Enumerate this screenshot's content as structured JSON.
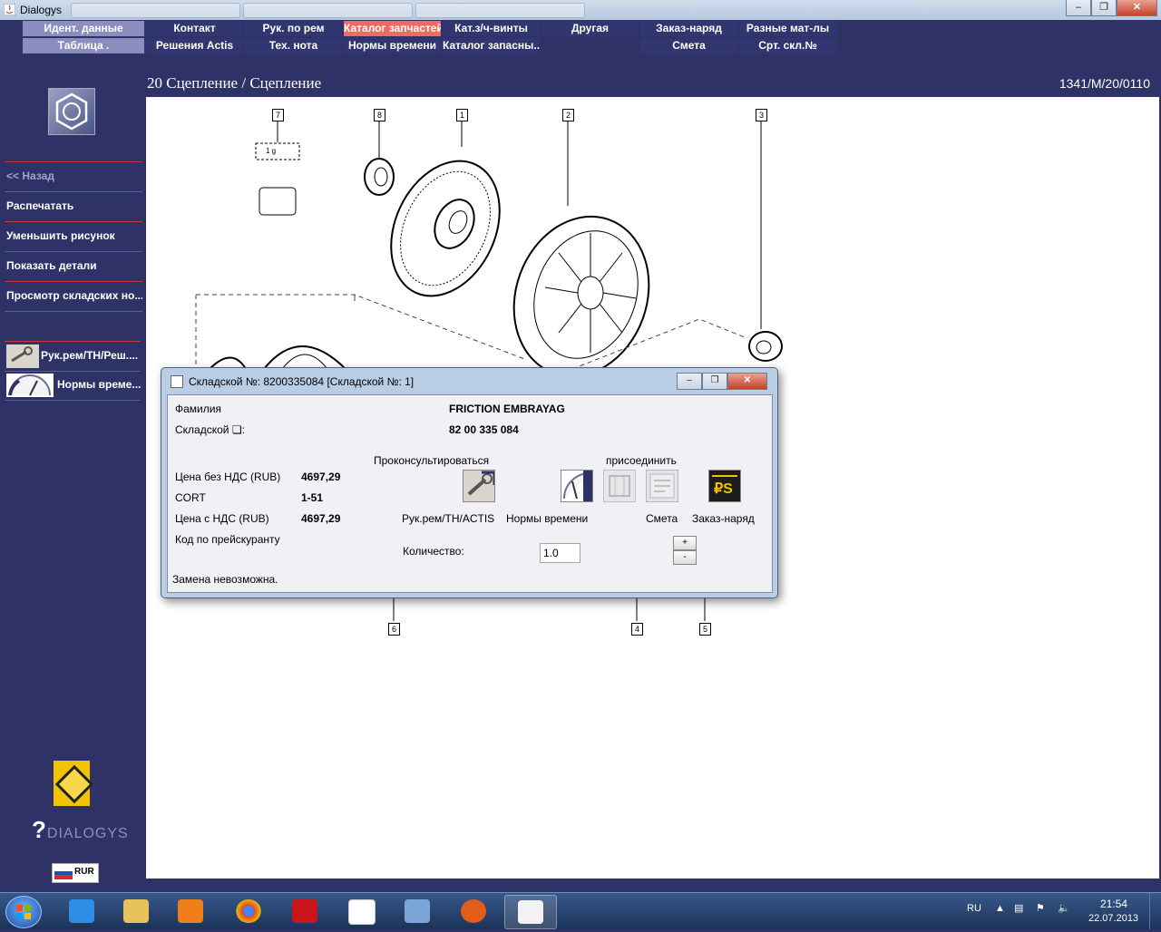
{
  "window": {
    "title": "Dialogys"
  },
  "nav": {
    "row1": [
      "Идент. данные",
      "Контакт",
      "Рук. по рем",
      "Каталог запчастей",
      "Кат.з/ч-винты",
      "Другая",
      "Заказ-наряд",
      "Разные мат-лы"
    ],
    "row2": [
      "Таблица .",
      "Решения Actis",
      "Тех. нота",
      "Нормы времени",
      "Каталог запасны...",
      "Смета",
      "Срт. скл.№"
    ]
  },
  "sidebar": {
    "back": "<< Назад",
    "print": "Распечатать",
    "shrink": "Уменьшить рисунок",
    "details": "Показать детали",
    "stock": "Просмотр складских но...",
    "repair": "Рук.рем/ТН/Реш....",
    "times": "Нормы време...",
    "brand_text": "DIALOGYS",
    "currency": "RUR"
  },
  "page": {
    "title": "20 Сцепление / Сцепление",
    "code": "1341/M/20/0110"
  },
  "diagram": {
    "callouts": [
      "7",
      "8",
      "1",
      "2",
      "3",
      "6",
      "4",
      "5"
    ],
    "label_1g": "1 g"
  },
  "dialog": {
    "title": "Складской №: 8200335084 [Складской №: 1]",
    "family_label": "Фамилия",
    "family_value": "FRICTION EMBRAYAG",
    "stock_label": "Складской ❏:",
    "stock_value": "82 00 335 084",
    "price_label": "Цена без НДС (RUB)",
    "price_value": "4697,29",
    "cort_label": "CORT",
    "cort_value": "1-51",
    "price_vat_label": "Цена с НДС (RUB)",
    "price_vat_value": "4697,29",
    "code_label": "Код по прейскуранту",
    "consult": "Проконсультироваться",
    "attach": "присоединить",
    "repair_label": "Рук.рем/ТН/ACTIS",
    "times_label": "Нормы времени",
    "estimate_label": "Смета",
    "order_label": "Заказ-наряд",
    "qty_label": "Количество:",
    "qty_value": "1.0",
    "plus": "+",
    "minus": "-",
    "status": "Замена невозможна."
  },
  "taskbar": {
    "lang": "RU",
    "time": "21:54",
    "date": "22.07.2013"
  },
  "colors": {
    "background": "#2f3267",
    "active_tab": "#ef6b61",
    "divider": "#c23a3a",
    "light_tab": "#8a8dbd"
  }
}
